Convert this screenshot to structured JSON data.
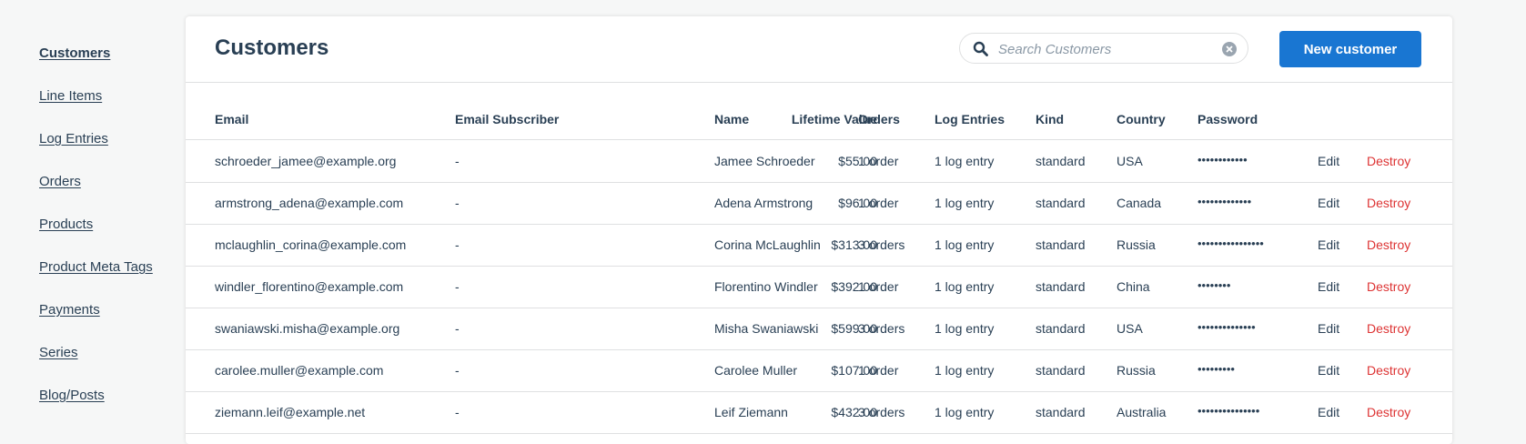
{
  "sidebar": {
    "items": [
      {
        "label": "Customers",
        "active": true
      },
      {
        "label": "Line Items"
      },
      {
        "label": "Log Entries"
      },
      {
        "label": "Orders"
      },
      {
        "label": "Products"
      },
      {
        "label": "Product Meta Tags"
      },
      {
        "label": "Payments"
      },
      {
        "label": "Series"
      },
      {
        "label": "Blog/Posts"
      }
    ]
  },
  "header": {
    "title": "Customers",
    "search_placeholder": "Search Customers",
    "new_button_label": "New customer"
  },
  "table": {
    "columns": [
      "Email",
      "Email Subscriber",
      "Lifetime Value",
      "Name",
      "Orders",
      "Log Entries",
      "Kind",
      "Country",
      "Password"
    ],
    "action_labels": {
      "edit": "Edit",
      "destroy": "Destroy"
    },
    "rows": [
      {
        "email": "schroeder_jamee@example.org",
        "subscriber": "-",
        "lifetime_value": "$55.00",
        "name": "Jamee Schroeder",
        "orders": "1 order",
        "log_entries": "1 log entry",
        "kind": "standard",
        "country": "USA",
        "password": "••••••••••••"
      },
      {
        "email": "armstrong_adena@example.com",
        "subscriber": "-",
        "lifetime_value": "$96.00",
        "name": "Adena Armstrong",
        "orders": "1 order",
        "log_entries": "1 log entry",
        "kind": "standard",
        "country": "Canada",
        "password": "•••••••••••••"
      },
      {
        "email": "mclaughlin_corina@example.com",
        "subscriber": "-",
        "lifetime_value": "$313.00",
        "name": "Corina McLaughlin",
        "orders": "3 orders",
        "log_entries": "1 log entry",
        "kind": "standard",
        "country": "Russia",
        "password": "••••••••••••••••"
      },
      {
        "email": "windler_florentino@example.com",
        "subscriber": "-",
        "lifetime_value": "$392.00",
        "name": "Florentino Windler",
        "orders": "1 order",
        "log_entries": "1 log entry",
        "kind": "standard",
        "country": "China",
        "password": "••••••••"
      },
      {
        "email": "swaniawski.misha@example.org",
        "subscriber": "-",
        "lifetime_value": "$599.00",
        "name": "Misha Swaniawski",
        "orders": "3 orders",
        "log_entries": "1 log entry",
        "kind": "standard",
        "country": "USA",
        "password": "••••••••••••••"
      },
      {
        "email": "carolee.muller@example.com",
        "subscriber": "-",
        "lifetime_value": "$107.00",
        "name": "Carolee Muller",
        "orders": "1 order",
        "log_entries": "1 log entry",
        "kind": "standard",
        "country": "Russia",
        "password": "•••••••••"
      },
      {
        "email": "ziemann.leif@example.net",
        "subscriber": "-",
        "lifetime_value": "$432.00",
        "name": "Leif Ziemann",
        "orders": "3 orders",
        "log_entries": "1 log entry",
        "kind": "standard",
        "country": "Australia",
        "password": "•••••••••••••••"
      }
    ]
  },
  "colors": {
    "accent": "#1976d2",
    "text": "#293f54",
    "destroy": "#dd3333",
    "border": "#dfe0e1",
    "background": "#f6f7f7"
  },
  "icons": {
    "search": "search-icon",
    "clear": "close-circle-icon"
  }
}
